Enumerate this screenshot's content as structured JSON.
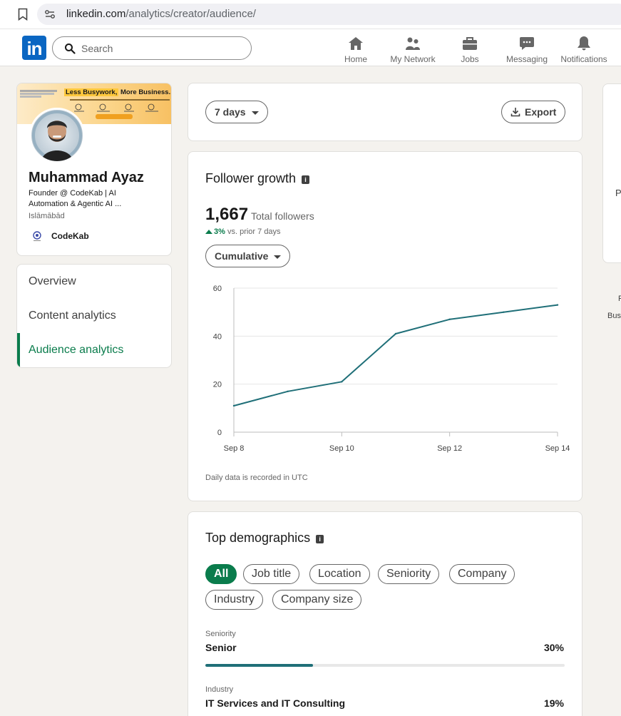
{
  "browser": {
    "url_host": "linkedin.com",
    "url_path": "/analytics/creator/audience/"
  },
  "nav": {
    "logo": "in",
    "search_placeholder": "Search",
    "items": [
      {
        "label": "Home",
        "icon": "home-icon"
      },
      {
        "label": "My Network",
        "icon": "network-icon"
      },
      {
        "label": "Jobs",
        "icon": "briefcase-icon"
      },
      {
        "label": "Messaging",
        "icon": "chat-icon"
      },
      {
        "label": "Notifications",
        "icon": "bell-icon"
      }
    ]
  },
  "profile": {
    "banner_headline_highlight": "Less Busywork,",
    "banner_headline_rest": " More Business.",
    "name": "Muhammad Ayaz",
    "headline": "Founder @ CodeKab | AI Automation & Agentic AI ...",
    "location": "Islāmābād",
    "company": "CodeKab"
  },
  "menu": {
    "items": [
      "Overview",
      "Content analytics",
      "Audience analytics"
    ],
    "active": "Audience analytics"
  },
  "filters": {
    "range_label": "7 days",
    "export_label": "Export"
  },
  "growth": {
    "title": "Follower growth",
    "total": "1,667",
    "total_label": "Total followers",
    "delta": "3%",
    "delta_label": "vs. prior 7 days",
    "mode_label": "Cumulative",
    "note": "Daily data is recorded in UTC"
  },
  "chart_data": {
    "type": "line",
    "x": [
      "Sep 8",
      "Sep 9",
      "Sep 10",
      "Sep 11",
      "Sep 12",
      "Sep 13",
      "Sep 14"
    ],
    "x_tick_labels": [
      "Sep 8",
      "Sep 10",
      "Sep 12",
      "Sep 14"
    ],
    "series": [
      {
        "values": [
          11,
          17,
          21,
          41,
          47,
          50,
          53
        ]
      }
    ],
    "y_ticks": [
      0,
      20,
      40,
      60
    ],
    "ylim": [
      0,
      60
    ],
    "grid": true,
    "color": "#1f6f78"
  },
  "demographics": {
    "title": "Top demographics",
    "chips": [
      "All",
      "Job title",
      "Location",
      "Seniority",
      "Company",
      "Industry",
      "Company size"
    ],
    "selected_chip": "All",
    "rows": [
      {
        "category": "Seniority",
        "value": "Senior",
        "percent": "30%",
        "fraction": 0.3
      },
      {
        "category": "Industry",
        "value": "IT Services and IT Consulting",
        "percent": "19%",
        "fraction": 0.19
      }
    ]
  },
  "side_fragments": [
    "P",
    "F",
    "Bus"
  ],
  "colors": {
    "brand": "#0a66c2",
    "accent": "#0a7c4c",
    "line": "#1f6f78"
  }
}
